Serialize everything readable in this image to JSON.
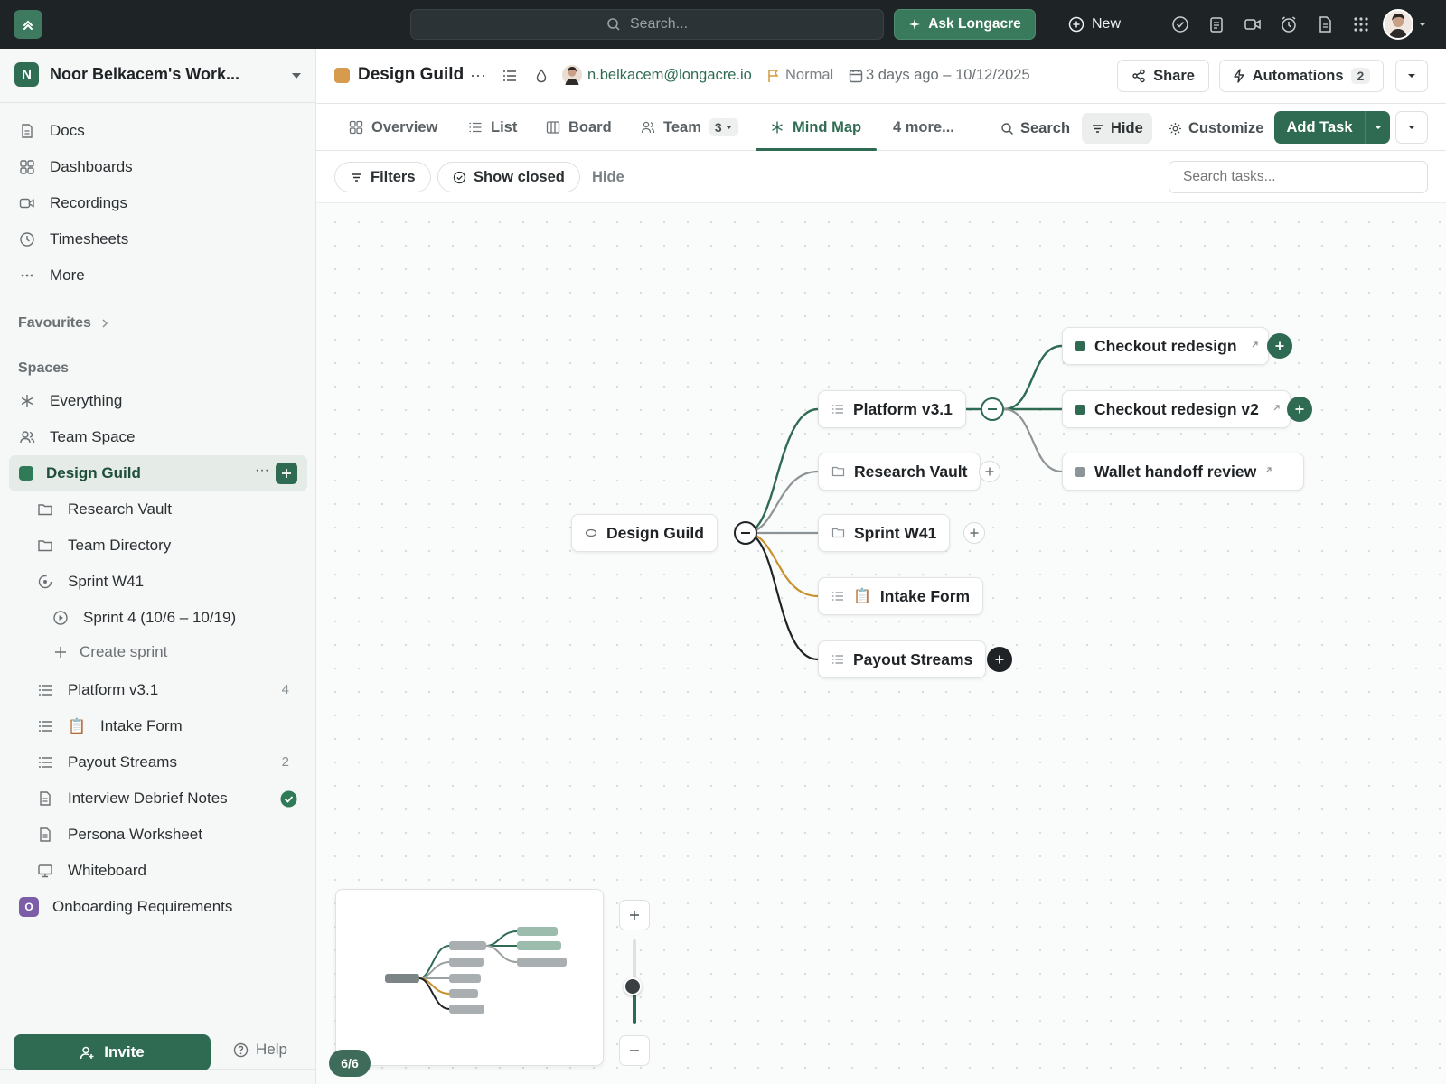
{
  "topbar": {
    "search_placeholder": "Search...",
    "ask_label": "Ask Longacre",
    "new_label": "New",
    "icons": [
      "check-circle-icon",
      "clipboard-icon",
      "video-icon",
      "alarm-icon",
      "document-icon",
      "apps-grid-icon"
    ]
  },
  "sidebar": {
    "workspace_initial": "N",
    "workspace_name": "Noor Belkacem's Work...",
    "nav": [
      {
        "label": "Docs",
        "icon": "doc-icon"
      },
      {
        "label": "Dashboards",
        "icon": "dashboard-icon"
      },
      {
        "label": "Recordings",
        "icon": "video-icon"
      },
      {
        "label": "Timesheets",
        "icon": "clock-icon"
      },
      {
        "label": "More",
        "icon": "ellipsis-icon"
      }
    ],
    "favourites_label": "Favourites",
    "spaces_label": "Spaces",
    "spaces": [
      {
        "label": "Everything",
        "icon": "asterisk-icon"
      },
      {
        "label": "Team Space",
        "icon": "people-icon"
      }
    ],
    "active_space": "Design Guild",
    "tree": [
      {
        "label": "Research Vault",
        "icon": "folder-icon",
        "count": ""
      },
      {
        "label": "Team Directory",
        "icon": "folder-icon",
        "count": ""
      },
      {
        "label": "Sprint W41",
        "icon": "sprint-icon",
        "count": ""
      },
      {
        "label": "Sprint 4 (10/6 – 10/19)",
        "icon": "play-circle-icon",
        "count": ""
      },
      {
        "label": "Create sprint",
        "icon": "plus-icon",
        "count": ""
      },
      {
        "label": "Platform v3.1",
        "icon": "list-icon",
        "count": "4"
      },
      {
        "label": "Intake Form",
        "icon": "list-icon",
        "emoji": "📋",
        "count": ""
      },
      {
        "label": "Payout Streams",
        "icon": "list-icon",
        "count": "2"
      },
      {
        "label": "Interview Debrief Notes",
        "icon": "doc-icon",
        "count": ""
      },
      {
        "label": "Persona Worksheet",
        "icon": "doc-icon",
        "count": ""
      },
      {
        "label": "Whiteboard",
        "icon": "whiteboard-icon",
        "count": ""
      }
    ],
    "other_space_initial": "O",
    "other_space": "Onboarding Requirements",
    "invite_label": "Invite",
    "help_label": "Help"
  },
  "header": {
    "title": "Design Guild",
    "more": "···",
    "owner_email": "n.belkacem@longacre.io",
    "priority": "Normal",
    "dates": "3 days ago – 10/12/2025",
    "share_label": "Share",
    "automations_label": "Automations",
    "automations_count": "2"
  },
  "tabs": {
    "items": [
      "Overview",
      "List",
      "Board",
      "Team",
      "Mind Map",
      "4 more..."
    ],
    "team_count": "3",
    "active": "Mind Map",
    "search_label": "Search",
    "hide_label": "Hide",
    "customize_label": "Customize",
    "add_task_label": "Add Task"
  },
  "filters": {
    "filters_label": "Filters",
    "show_closed_label": "Show closed",
    "hide_label": "Hide",
    "search_placeholder": "Search tasks..."
  },
  "mindmap": {
    "root": "Design Guild",
    "children": [
      "Platform v3.1",
      "Research Vault",
      "Sprint W41",
      "Intake Form",
      "Payout Streams"
    ],
    "intake_emoji": "📋",
    "grandchildren": [
      "Checkout redesign",
      "Checkout redesign v2",
      "Wallet handoff review"
    ],
    "colors": {
      "green": "#2f6b52",
      "gray": "#8d9497",
      "orange": "#c8922e",
      "dark": "#1f2326"
    }
  },
  "canvas_controls": {
    "page_indicator": "6/6",
    "zoom_level": 0.45
  }
}
